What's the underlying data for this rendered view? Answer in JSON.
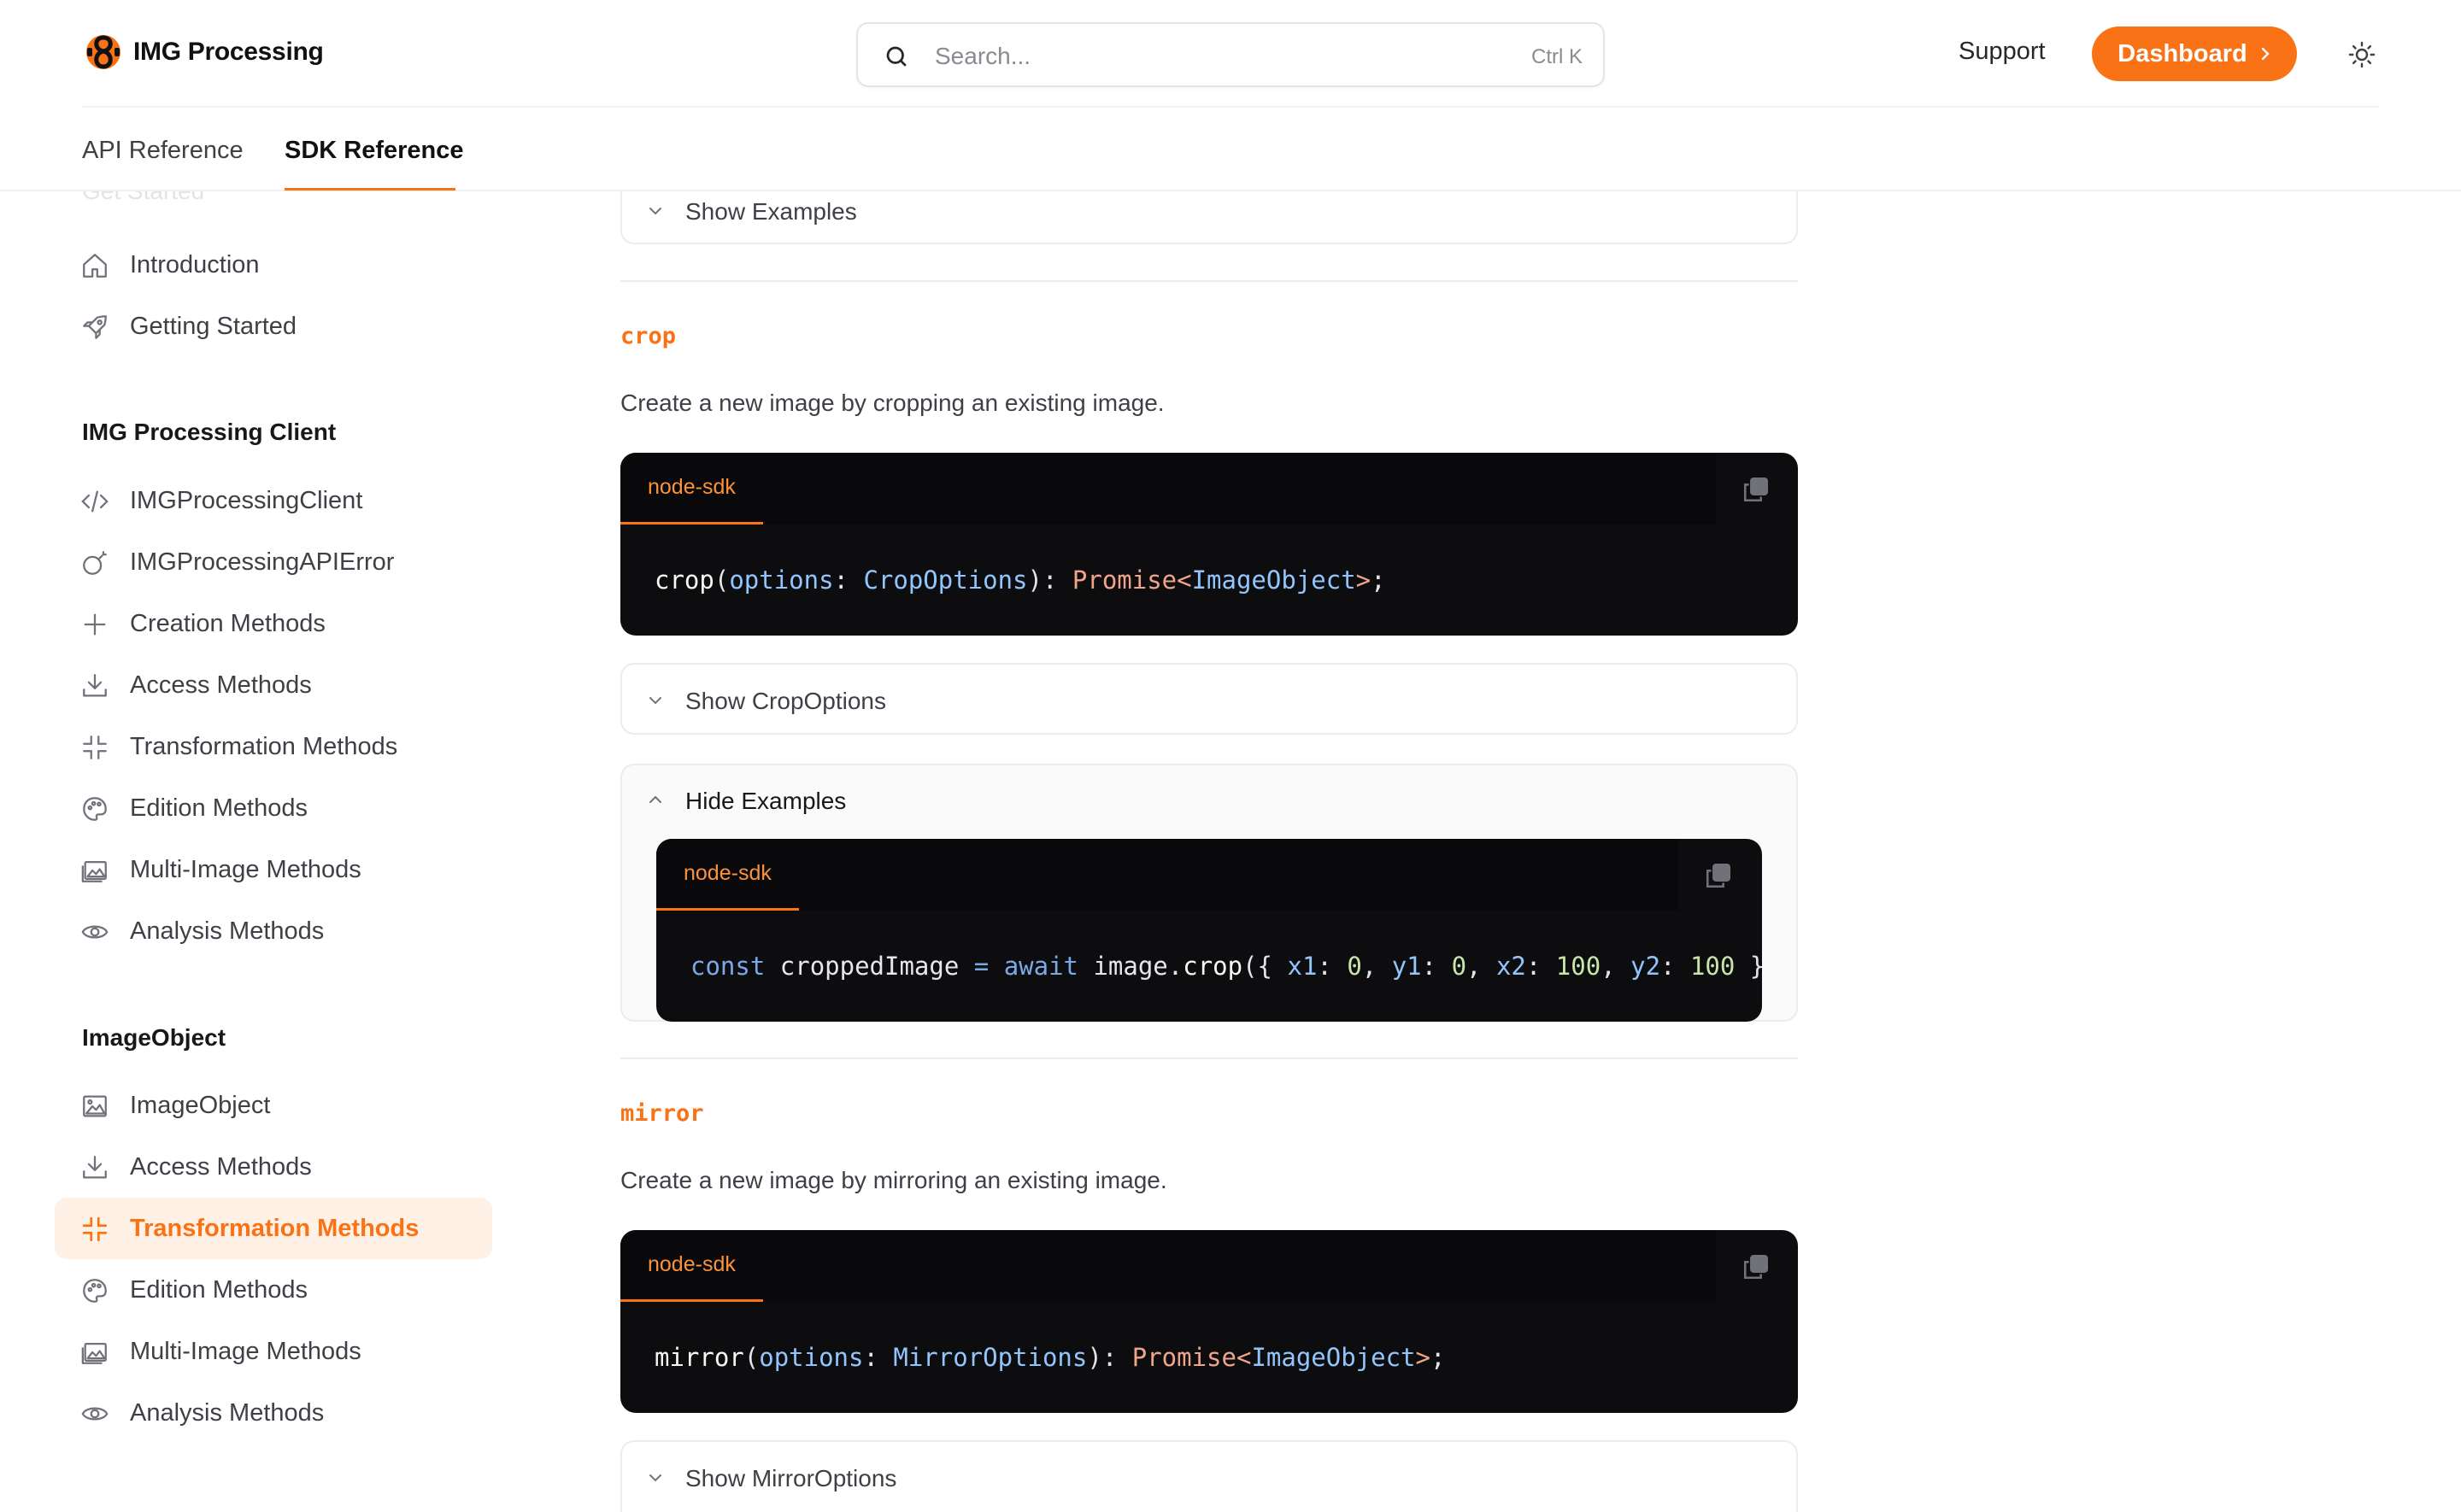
{
  "brand": {
    "name": "IMG Processing"
  },
  "search": {
    "placeholder": "Search...",
    "shortcut": "Ctrl K"
  },
  "header": {
    "support": "Support",
    "dashboard": "Dashboard"
  },
  "tabs": [
    {
      "label": "API Reference"
    },
    {
      "label": "SDK Reference",
      "active": true
    }
  ],
  "sidebar": {
    "faded_heading": "Get Started",
    "top_items": [
      {
        "label": "Introduction",
        "icon": "home-icon"
      },
      {
        "label": "Getting Started",
        "icon": "rocket-icon"
      }
    ],
    "client_section": {
      "title": "IMG Processing Client",
      "items": [
        {
          "label": "IMGProcessingClient",
          "icon": "code-icon"
        },
        {
          "label": "IMGProcessingAPIError",
          "icon": "bomb-icon"
        },
        {
          "label": "Creation Methods",
          "icon": "plus-icon"
        },
        {
          "label": "Access Methods",
          "icon": "download-icon"
        },
        {
          "label": "Transformation Methods",
          "icon": "shrink-icon"
        },
        {
          "label": "Edition Methods",
          "icon": "palette-icon"
        },
        {
          "label": "Multi-Image Methods",
          "icon": "images-icon"
        },
        {
          "label": "Analysis Methods",
          "icon": "eye-icon"
        }
      ]
    },
    "image_section": {
      "title": "ImageObject",
      "items": [
        {
          "label": "ImageObject",
          "icon": "image-icon"
        },
        {
          "label": "Access Methods",
          "icon": "download-icon"
        },
        {
          "label": "Transformation Methods",
          "icon": "shrink-icon",
          "active": true
        },
        {
          "label": "Edition Methods",
          "icon": "palette-icon"
        },
        {
          "label": "Multi-Image Methods",
          "icon": "images-icon"
        },
        {
          "label": "Analysis Methods",
          "icon": "eye-icon"
        }
      ]
    }
  },
  "main": {
    "show_examples_top": "Show Examples",
    "crop": {
      "name": "crop",
      "description": "Create a new image by cropping an existing image.",
      "code_tab": "node-sdk",
      "signature": {
        "fn": "crop",
        "param": "options",
        "type": "CropOptions",
        "promise": "Promise",
        "return_type": "ImageObject"
      },
      "options_toggle": "Show CropOptions",
      "examples_toggle": "Hide Examples",
      "example": {
        "tab": "node-sdk",
        "kw_const": "const",
        "var": "croppedImage",
        "kw_await": "await",
        "obj": "image",
        "method": "crop",
        "args": [
          {
            "key": "x1",
            "value": "0"
          },
          {
            "key": "y1",
            "value": "0"
          },
          {
            "key": "x2",
            "value": "100"
          },
          {
            "key": "y2",
            "value": "100"
          }
        ]
      }
    },
    "mirror": {
      "name": "mirror",
      "description": "Create a new image by mirroring an existing image.",
      "code_tab": "node-sdk",
      "signature": {
        "fn": "mirror",
        "param": "options",
        "type": "MirrorOptions",
        "promise": "Promise",
        "return_type": "ImageObject"
      },
      "options_toggle": "Show MirrorOptions"
    }
  },
  "colors": {
    "accent": "#f97316",
    "code_bg": "#0d0d10",
    "active_bg": "#fff1e6"
  }
}
